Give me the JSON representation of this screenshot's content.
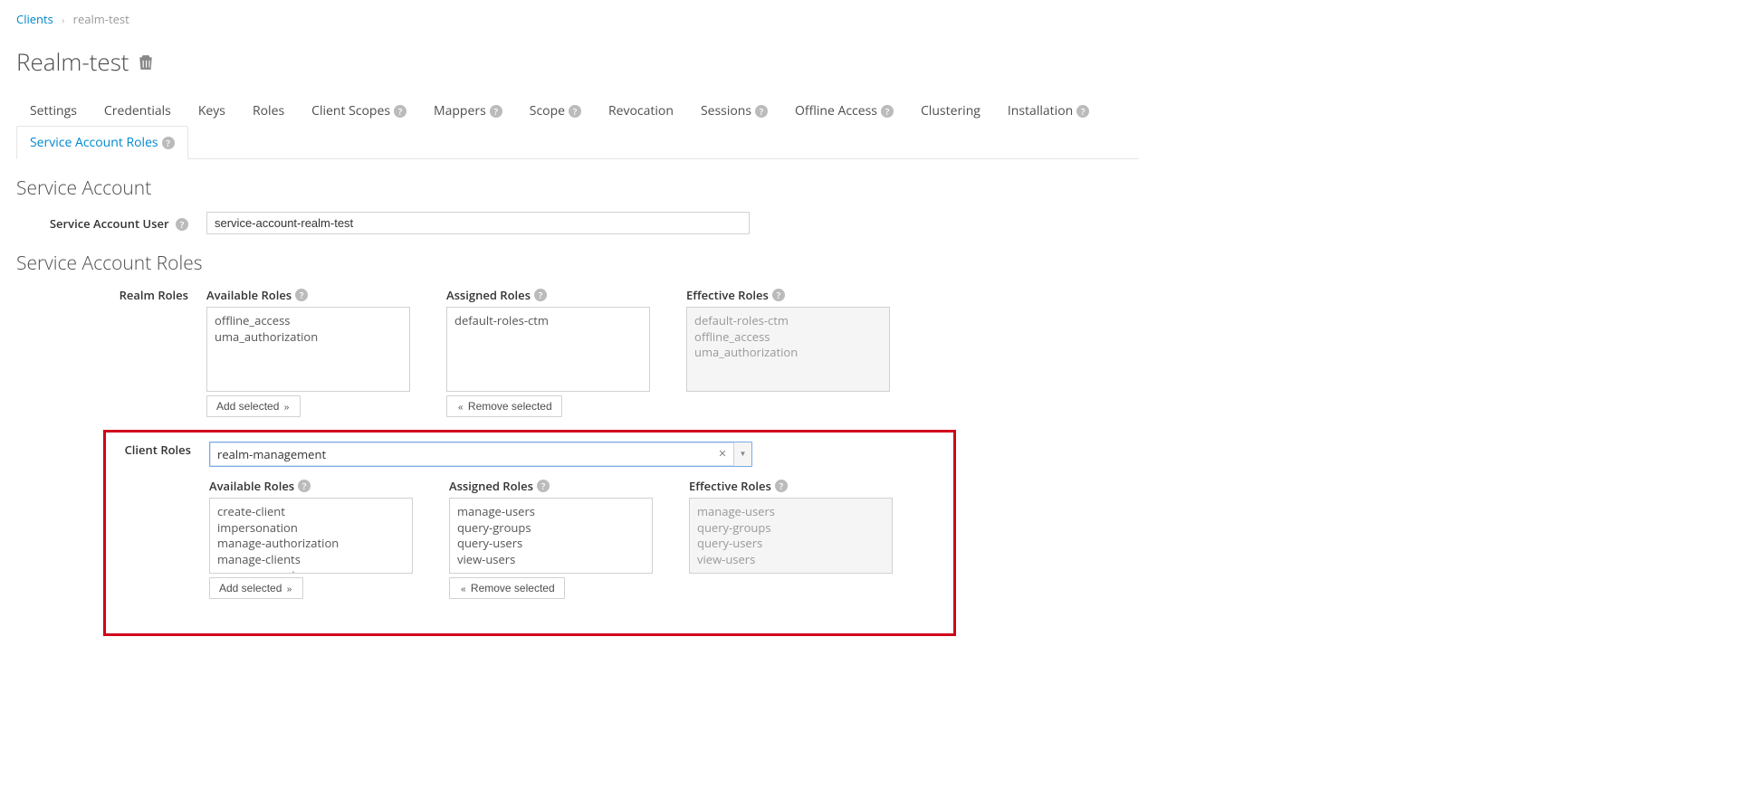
{
  "breadcrumb": {
    "link": "Clients",
    "current": "realm-test"
  },
  "page_title": "Realm-test",
  "tabs": [
    {
      "label": "Settings",
      "help": false
    },
    {
      "label": "Credentials",
      "help": false
    },
    {
      "label": "Keys",
      "help": false
    },
    {
      "label": "Roles",
      "help": false
    },
    {
      "label": "Client Scopes",
      "help": true
    },
    {
      "label": "Mappers",
      "help": true
    },
    {
      "label": "Scope",
      "help": true
    },
    {
      "label": "Revocation",
      "help": false
    },
    {
      "label": "Sessions",
      "help": true
    },
    {
      "label": "Offline Access",
      "help": true
    },
    {
      "label": "Clustering",
      "help": false
    },
    {
      "label": "Installation",
      "help": true
    },
    {
      "label": "Service Account Roles",
      "help": true,
      "active": true
    }
  ],
  "section_service_account": "Service Account",
  "service_account_user_label": "Service Account User",
  "service_account_user_value": "service-account-realm-test",
  "section_roles_title": "Service Account Roles",
  "realm_roles": {
    "label": "Realm Roles",
    "available_header": "Available Roles",
    "assigned_header": "Assigned Roles",
    "effective_header": "Effective Roles",
    "available": [
      "offline_access",
      "uma_authorization"
    ],
    "assigned": [
      "default-roles-ctm"
    ],
    "effective": [
      "default-roles-ctm",
      "offline_access",
      "uma_authorization"
    ]
  },
  "client_roles": {
    "label": "Client Roles",
    "selected_client": "realm-management",
    "available_header": "Available Roles",
    "assigned_header": "Assigned Roles",
    "effective_header": "Effective Roles",
    "available": [
      "create-client",
      "impersonation",
      "manage-authorization",
      "manage-clients",
      "manage-events"
    ],
    "assigned": [
      "manage-users",
      "query-groups",
      "query-users",
      "view-users"
    ],
    "effective": [
      "manage-users",
      "query-groups",
      "query-users",
      "view-users"
    ]
  },
  "buttons": {
    "add_selected": "Add selected",
    "remove_selected": "Remove selected"
  }
}
